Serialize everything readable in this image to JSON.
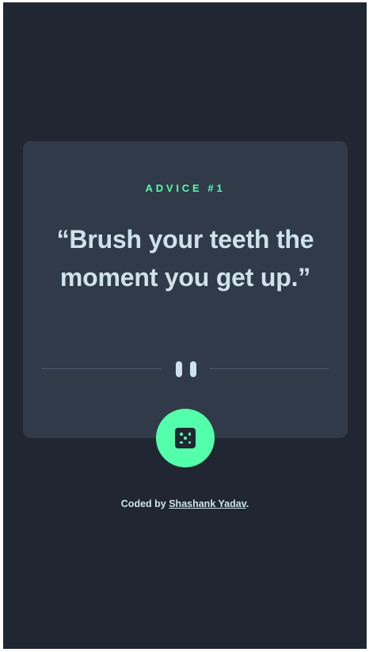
{
  "card": {
    "advice_label": "ADVICE",
    "advice_number": "#1",
    "quote": "“Brush your teeth the moment you get up.”"
  },
  "controls": {
    "divider_icon": "pause-icon",
    "dice_button_icon": "dice-icon"
  },
  "footer": {
    "prefix": "Coded by",
    "author": "Shashank Yadav",
    "suffix": "."
  },
  "colors": {
    "background": "#202632",
    "card": "#313a49",
    "accent": "#53ffaa",
    "text": "#cee3e9",
    "divider": "#4f5d74"
  }
}
